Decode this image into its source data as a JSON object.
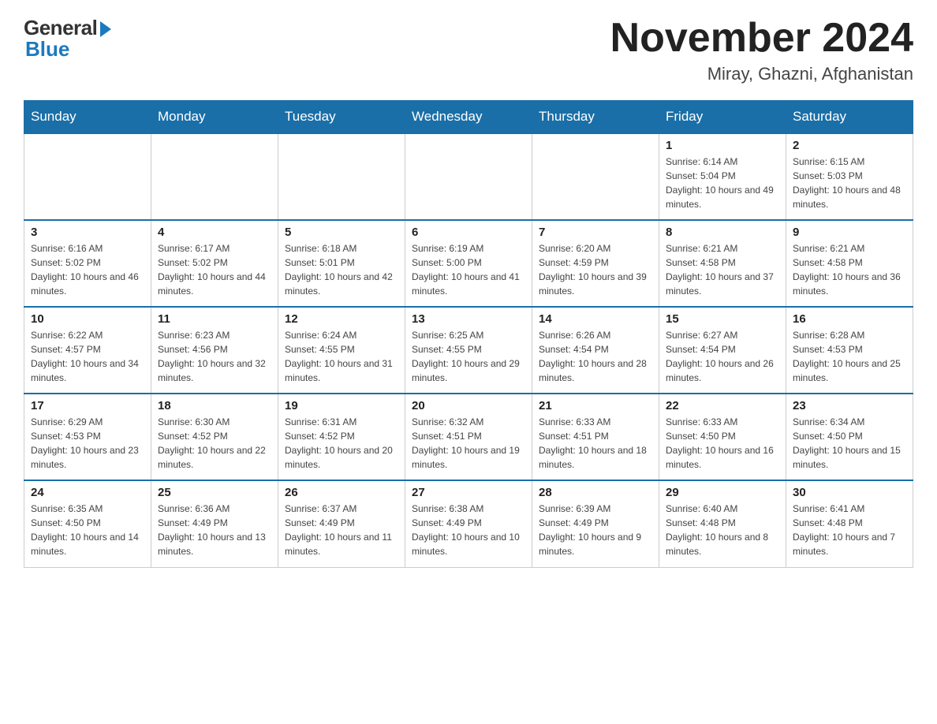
{
  "logo": {
    "general": "General",
    "blue": "Blue"
  },
  "header": {
    "month": "November 2024",
    "location": "Miray, Ghazni, Afghanistan"
  },
  "weekdays": [
    "Sunday",
    "Monday",
    "Tuesday",
    "Wednesday",
    "Thursday",
    "Friday",
    "Saturday"
  ],
  "weeks": [
    [
      {
        "day": "",
        "info": ""
      },
      {
        "day": "",
        "info": ""
      },
      {
        "day": "",
        "info": ""
      },
      {
        "day": "",
        "info": ""
      },
      {
        "day": "",
        "info": ""
      },
      {
        "day": "1",
        "info": "Sunrise: 6:14 AM\nSunset: 5:04 PM\nDaylight: 10 hours and 49 minutes."
      },
      {
        "day": "2",
        "info": "Sunrise: 6:15 AM\nSunset: 5:03 PM\nDaylight: 10 hours and 48 minutes."
      }
    ],
    [
      {
        "day": "3",
        "info": "Sunrise: 6:16 AM\nSunset: 5:02 PM\nDaylight: 10 hours and 46 minutes."
      },
      {
        "day": "4",
        "info": "Sunrise: 6:17 AM\nSunset: 5:02 PM\nDaylight: 10 hours and 44 minutes."
      },
      {
        "day": "5",
        "info": "Sunrise: 6:18 AM\nSunset: 5:01 PM\nDaylight: 10 hours and 42 minutes."
      },
      {
        "day": "6",
        "info": "Sunrise: 6:19 AM\nSunset: 5:00 PM\nDaylight: 10 hours and 41 minutes."
      },
      {
        "day": "7",
        "info": "Sunrise: 6:20 AM\nSunset: 4:59 PM\nDaylight: 10 hours and 39 minutes."
      },
      {
        "day": "8",
        "info": "Sunrise: 6:21 AM\nSunset: 4:58 PM\nDaylight: 10 hours and 37 minutes."
      },
      {
        "day": "9",
        "info": "Sunrise: 6:21 AM\nSunset: 4:58 PM\nDaylight: 10 hours and 36 minutes."
      }
    ],
    [
      {
        "day": "10",
        "info": "Sunrise: 6:22 AM\nSunset: 4:57 PM\nDaylight: 10 hours and 34 minutes."
      },
      {
        "day": "11",
        "info": "Sunrise: 6:23 AM\nSunset: 4:56 PM\nDaylight: 10 hours and 32 minutes."
      },
      {
        "day": "12",
        "info": "Sunrise: 6:24 AM\nSunset: 4:55 PM\nDaylight: 10 hours and 31 minutes."
      },
      {
        "day": "13",
        "info": "Sunrise: 6:25 AM\nSunset: 4:55 PM\nDaylight: 10 hours and 29 minutes."
      },
      {
        "day": "14",
        "info": "Sunrise: 6:26 AM\nSunset: 4:54 PM\nDaylight: 10 hours and 28 minutes."
      },
      {
        "day": "15",
        "info": "Sunrise: 6:27 AM\nSunset: 4:54 PM\nDaylight: 10 hours and 26 minutes."
      },
      {
        "day": "16",
        "info": "Sunrise: 6:28 AM\nSunset: 4:53 PM\nDaylight: 10 hours and 25 minutes."
      }
    ],
    [
      {
        "day": "17",
        "info": "Sunrise: 6:29 AM\nSunset: 4:53 PM\nDaylight: 10 hours and 23 minutes."
      },
      {
        "day": "18",
        "info": "Sunrise: 6:30 AM\nSunset: 4:52 PM\nDaylight: 10 hours and 22 minutes."
      },
      {
        "day": "19",
        "info": "Sunrise: 6:31 AM\nSunset: 4:52 PM\nDaylight: 10 hours and 20 minutes."
      },
      {
        "day": "20",
        "info": "Sunrise: 6:32 AM\nSunset: 4:51 PM\nDaylight: 10 hours and 19 minutes."
      },
      {
        "day": "21",
        "info": "Sunrise: 6:33 AM\nSunset: 4:51 PM\nDaylight: 10 hours and 18 minutes."
      },
      {
        "day": "22",
        "info": "Sunrise: 6:33 AM\nSunset: 4:50 PM\nDaylight: 10 hours and 16 minutes."
      },
      {
        "day": "23",
        "info": "Sunrise: 6:34 AM\nSunset: 4:50 PM\nDaylight: 10 hours and 15 minutes."
      }
    ],
    [
      {
        "day": "24",
        "info": "Sunrise: 6:35 AM\nSunset: 4:50 PM\nDaylight: 10 hours and 14 minutes."
      },
      {
        "day": "25",
        "info": "Sunrise: 6:36 AM\nSunset: 4:49 PM\nDaylight: 10 hours and 13 minutes."
      },
      {
        "day": "26",
        "info": "Sunrise: 6:37 AM\nSunset: 4:49 PM\nDaylight: 10 hours and 11 minutes."
      },
      {
        "day": "27",
        "info": "Sunrise: 6:38 AM\nSunset: 4:49 PM\nDaylight: 10 hours and 10 minutes."
      },
      {
        "day": "28",
        "info": "Sunrise: 6:39 AM\nSunset: 4:49 PM\nDaylight: 10 hours and 9 minutes."
      },
      {
        "day": "29",
        "info": "Sunrise: 6:40 AM\nSunset: 4:48 PM\nDaylight: 10 hours and 8 minutes."
      },
      {
        "day": "30",
        "info": "Sunrise: 6:41 AM\nSunset: 4:48 PM\nDaylight: 10 hours and 7 minutes."
      }
    ]
  ]
}
